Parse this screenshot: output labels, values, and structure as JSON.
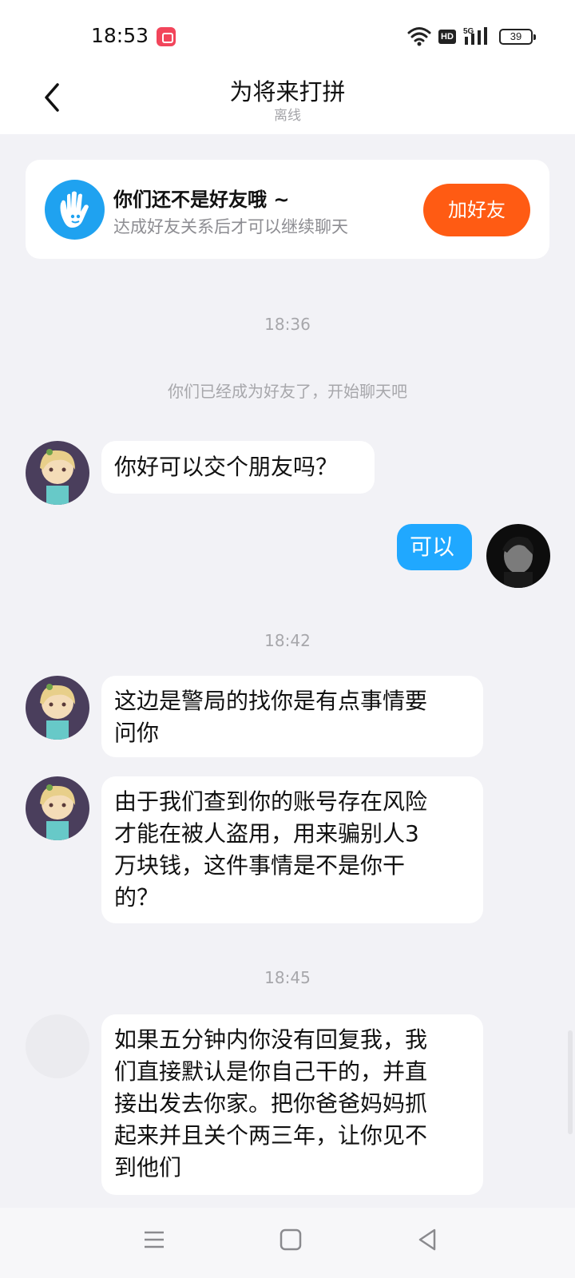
{
  "status_bar": {
    "time": "18:53",
    "battery": "39",
    "icons": [
      "video-record-icon",
      "wifi-icon",
      "hd-icon",
      "signal-5g-icon",
      "battery-icon"
    ]
  },
  "header": {
    "title": "为将来打拼",
    "subtitle": "离线",
    "back_icon": "chevron-left-icon"
  },
  "friend_notice": {
    "title": "你们还不是好友哦 ~",
    "description": "达成好友关系后才可以继续聊天",
    "button_label": "加好友",
    "icon": "hand-wave-icon"
  },
  "chat": {
    "time_1": "18:36",
    "system_message": "你们已经成为好友了，开始聊天吧",
    "msg_1": "你好可以交个朋友吗？",
    "msg_2": "可以",
    "time_2": "18:42",
    "msg_3_line1": "这边是警局的找你是有点事情要",
    "msg_3_line2": "问你",
    "msg_4_line1": "由于我们查到你的账号存在风险",
    "msg_4_line2": "才能在被人盗用，用来骗别人3",
    "msg_4_line3": "万块钱，这件事情是不是你干",
    "msg_4_line4": "的？",
    "time_3": "18:45",
    "msg_5_line1": "如果五分钟内你没有回复我，我",
    "msg_5_line2": "们直接默认是你自己干的，并直",
    "msg_5_line3": "接出发去你家。把你爸爸妈妈抓",
    "msg_5_line4": "起来并且关个两三年，让你见不",
    "msg_5_line5": "到他们"
  },
  "colors": {
    "accent_orange": "#ff5b13",
    "self_bubble": "#20a8ff",
    "background": "#f2f2f6"
  },
  "nav_bar": {
    "icons": [
      "menu-icon",
      "home-square-icon",
      "back-triangle-icon"
    ]
  }
}
